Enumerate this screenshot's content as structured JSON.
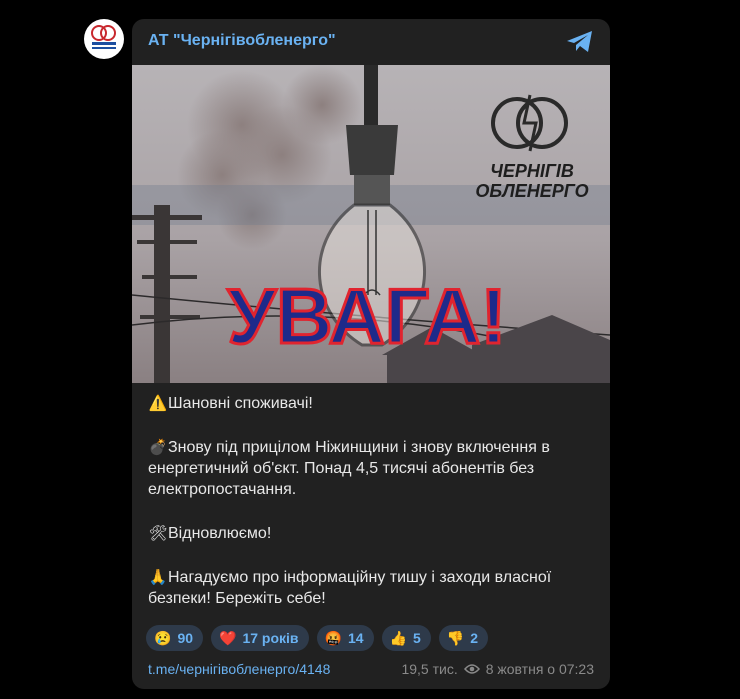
{
  "channel": {
    "name": "АТ \"Чернігівобленерго\""
  },
  "image": {
    "banner_text": "УВАГА!",
    "logo_line1": "ЧЕРНІГІВ",
    "logo_line2": "ОБЛЕНЕРГО"
  },
  "message": {
    "p1": "Шановні споживачі!",
    "p2": "Знову під прицілом Ніжинщини і знову включення в енергетичний об'єкт. Понад 4,5 тисячі абонентів без електропостачання.",
    "p3": "Відновлюємо!",
    "p4": "Нагадуємо про інформаційну тишу і заходи власної безпеки! Бережіть себе!"
  },
  "reactions": [
    {
      "emoji": "😢",
      "count": "90"
    },
    {
      "emoji": "❤️",
      "count": "17 років"
    },
    {
      "emoji": "🤬",
      "count": "14"
    },
    {
      "emoji": "👍",
      "count": "5"
    },
    {
      "emoji": "👎",
      "count": "2"
    }
  ],
  "footer": {
    "link": "t.me/чернігівобленерго/4148",
    "views": "19,5 тис.",
    "date": "8 жовтня о 07:23"
  },
  "colors": {
    "accent": "#6ab2f2",
    "card": "#212121",
    "banner_fill": "#1e2a8a",
    "banner_stroke": "#e0242f"
  }
}
